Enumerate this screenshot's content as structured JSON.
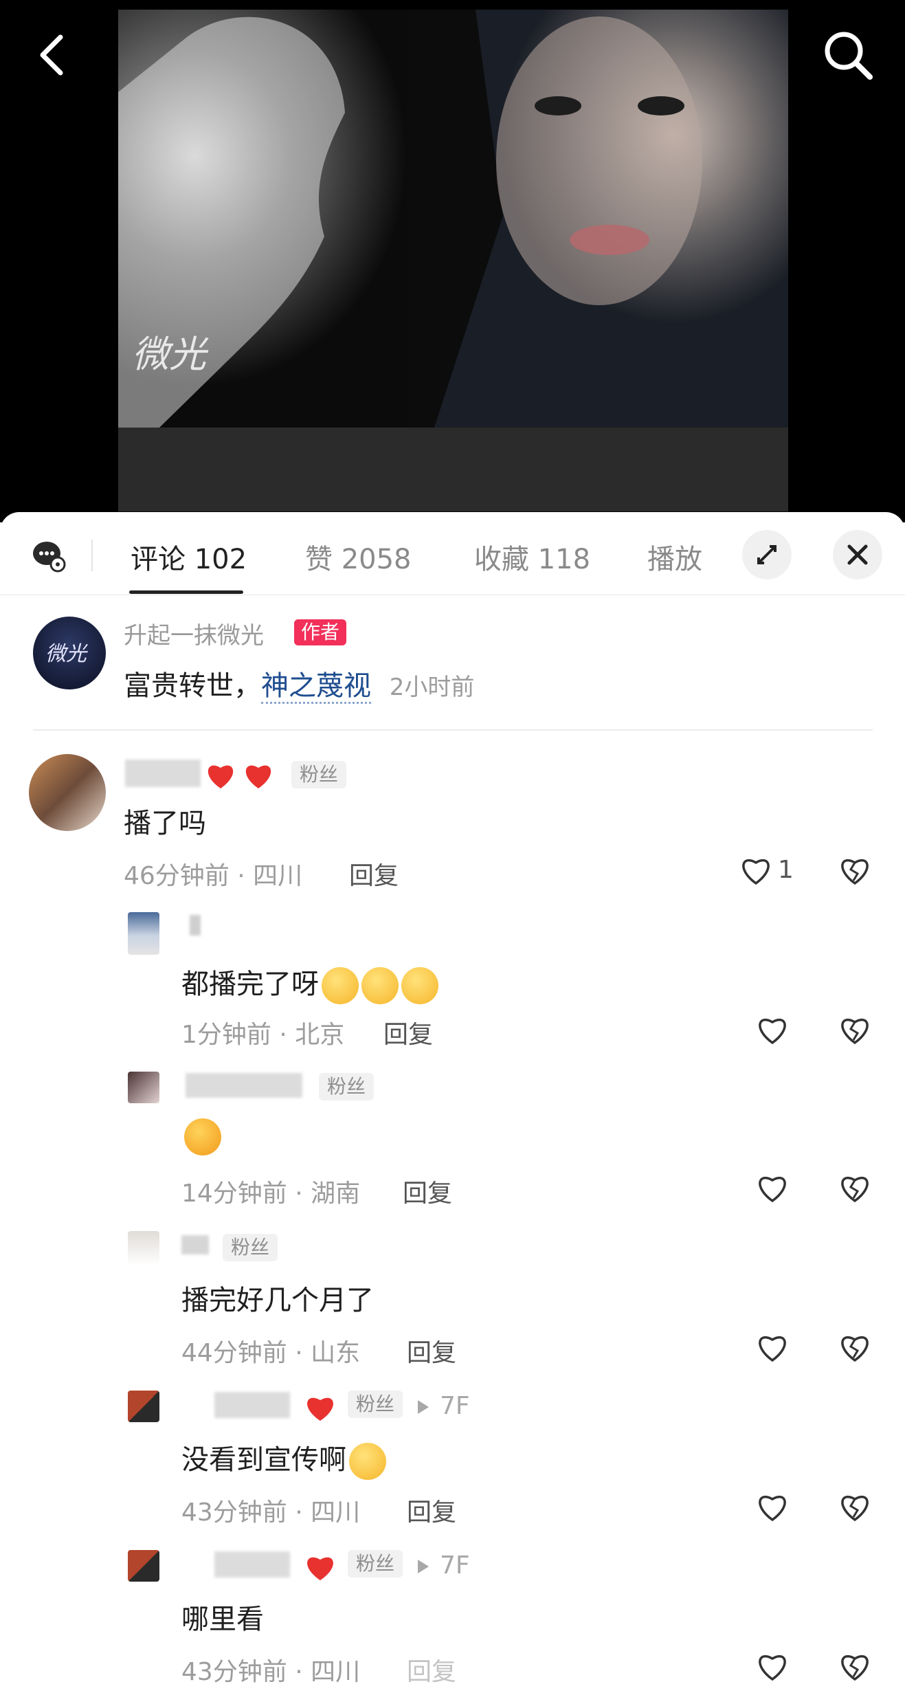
{
  "header": {
    "back_icon": "chevron-left-icon",
    "search_icon": "search-icon"
  },
  "video": {
    "watermark": "微光"
  },
  "tabs": [
    {
      "label": "评论 102",
      "active": true
    },
    {
      "label": "赞 2058",
      "active": false
    },
    {
      "label": "收藏 118",
      "active": false
    },
    {
      "label": "播放",
      "active": false
    }
  ],
  "author_comment": {
    "name": "升起一抹微光",
    "badge": "作者",
    "text_prefix": "富贵转世，",
    "link": "神之蔑视",
    "time": "2小时前"
  },
  "main_comment": {
    "badge": "粉丝",
    "text": "播了吗",
    "meta": "46分钟前 · 四川",
    "reply": "回复",
    "likes": "1"
  },
  "replies": [
    {
      "text": "都播完了呀",
      "meta": "1分钟前 · 北京",
      "reply": "回复",
      "badge": "",
      "floor": ""
    },
    {
      "text": "",
      "meta": "14分钟前 · 湖南",
      "reply": "回复",
      "badge": "粉丝",
      "floor": ""
    },
    {
      "text": "播完好几个月了",
      "meta": "44分钟前 · 山东",
      "reply": "回复",
      "badge": "粉丝",
      "floor": ""
    },
    {
      "text": "没看到宣传啊",
      "meta": "43分钟前 · 四川",
      "reply": "回复",
      "badge": "粉丝",
      "floor": "7F"
    },
    {
      "text": "哪里看",
      "meta": "43分钟前 · 四川",
      "reply": "回复",
      "badge": "粉丝",
      "floor": "7F"
    }
  ],
  "colors": {
    "author_badge": "#f2305a",
    "link": "#1f4d8f",
    "heart_red": "#e8322f"
  }
}
